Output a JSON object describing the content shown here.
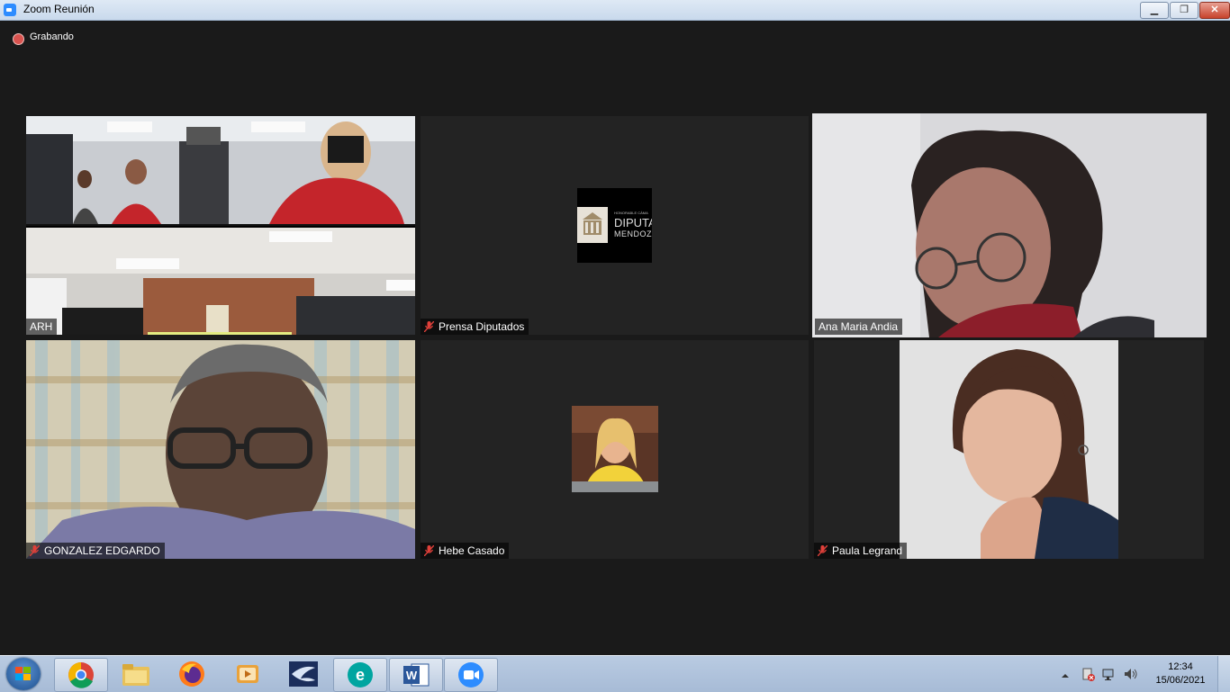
{
  "window": {
    "title": "Zoom Reunión"
  },
  "recording": {
    "label": "Grabando"
  },
  "participants": [
    {
      "name": "ARH",
      "muted": false
    },
    {
      "name": "Prensa Diputados",
      "muted": true,
      "logo_lines": [
        "HONORABLE CÁMA",
        "DIPUTA",
        "MENDOZ"
      ]
    },
    {
      "name": "Ana Maria Andia",
      "muted": false,
      "speaking": true
    },
    {
      "name": "GONZALEZ EDGARDO",
      "muted": true
    },
    {
      "name": "Hebe Casado",
      "muted": true
    },
    {
      "name": "Paula Legrand",
      "muted": true
    }
  ],
  "taskbar": {
    "apps": [
      "chrome-icon",
      "file-explorer-icon",
      "firefox-icon",
      "media-player-icon",
      "app-icon",
      "eset-icon",
      "word-icon",
      "zoom-icon"
    ],
    "clock": {
      "time": "12:34",
      "date": "15/06/2021"
    }
  },
  "colors": {
    "speaking_border": "#e4ec82",
    "background": "#1a1a1a",
    "muted_red": "#e0403a"
  }
}
